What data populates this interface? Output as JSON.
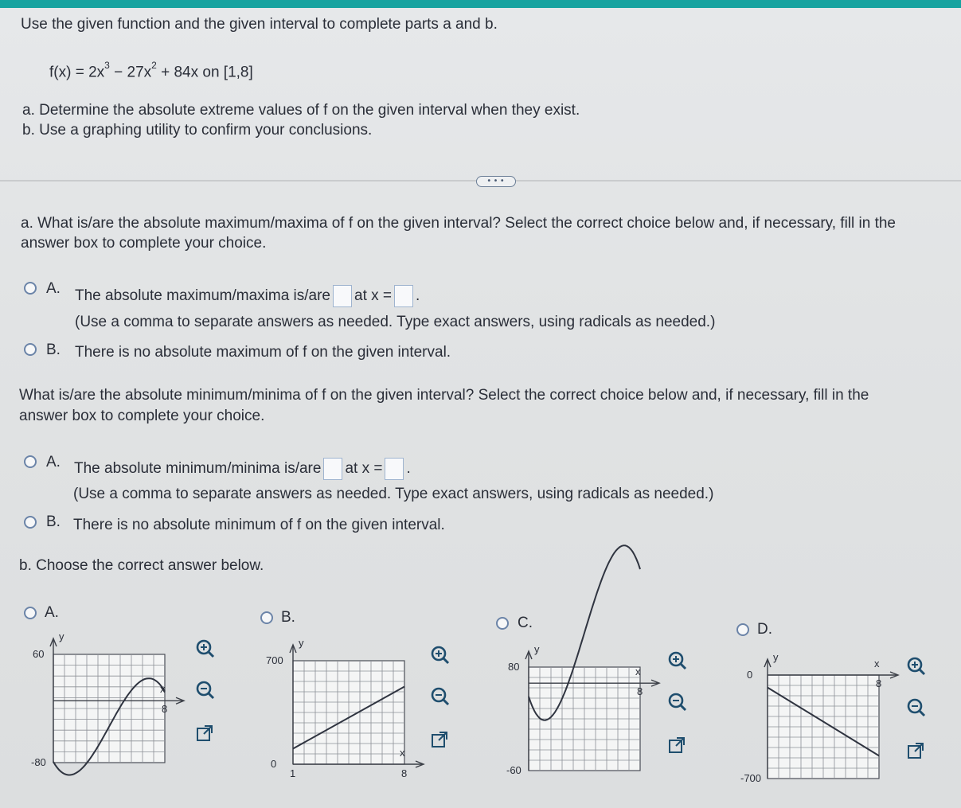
{
  "problem": {
    "instruction": "Use the given function and the given interval to complete parts a and b.",
    "function_prefix": "f(x) = 2x",
    "exp1": "3",
    "function_mid": " − 27x",
    "exp2": "2",
    "function_suffix": " + 84x on [1,8]",
    "part_a": "a. Determine the absolute extreme values of f on the given interval when they exist.",
    "part_b": "b. Use a graphing utility to confirm your conclusions."
  },
  "expand_label": "• • •",
  "q_max": {
    "prompt_line1": "a. What is/are the absolute maximum/maxima of f on the given interval? Select the correct choice below and, if necessary, fill in the",
    "prompt_line2": "answer box to complete your choice.",
    "choice_a_letter": "A.",
    "choice_a_text1": "The absolute maximum/maxima is/are",
    "choice_a_text2": "at x =",
    "choice_a_note": "(Use a comma to separate answers as needed. Type exact answers, using radicals as needed.)",
    "choice_b_letter": "B.",
    "choice_b_text": "There is no absolute maximum of f on the given interval."
  },
  "q_min": {
    "prompt_line1": "What is/are the absolute minimum/minima of f on the given interval? Select the correct choice below and, if necessary, fill in the",
    "prompt_line2": "answer box to complete your choice.",
    "choice_a_letter": "A.",
    "choice_a_text1": "The absolute minimum/minima is/are",
    "choice_a_text2": "at x =",
    "choice_a_note": "(Use a comma to separate answers as needed. Type exact answers, using radicals as needed.)",
    "choice_b_letter": "B.",
    "choice_b_text": "There is no absolute minimum of f on the given interval."
  },
  "part_b": {
    "prompt": "b. Choose the correct answer below.",
    "options": [
      {
        "letter": "A.",
        "ytop": "60",
        "ybottom": "-80",
        "xlabel": "x",
        "ylabel": "y",
        "xtick": "8"
      },
      {
        "letter": "B.",
        "ytop": "700",
        "ybottom": "0",
        "xlabel": "x",
        "ylabel": "y",
        "xstart": "1",
        "xtick": "8"
      },
      {
        "letter": "C.",
        "ytop": "80",
        "ybottom": "-60",
        "xlabel": "x",
        "ylabel": "y",
        "xtick": "8"
      },
      {
        "letter": "D.",
        "ytop": "0",
        "ybottom": "-700",
        "xlabel": "x",
        "ylabel": "y",
        "xtick": "8"
      }
    ]
  },
  "icons": [
    "zoom-in-icon",
    "zoom-out-icon",
    "popout-icon"
  ]
}
